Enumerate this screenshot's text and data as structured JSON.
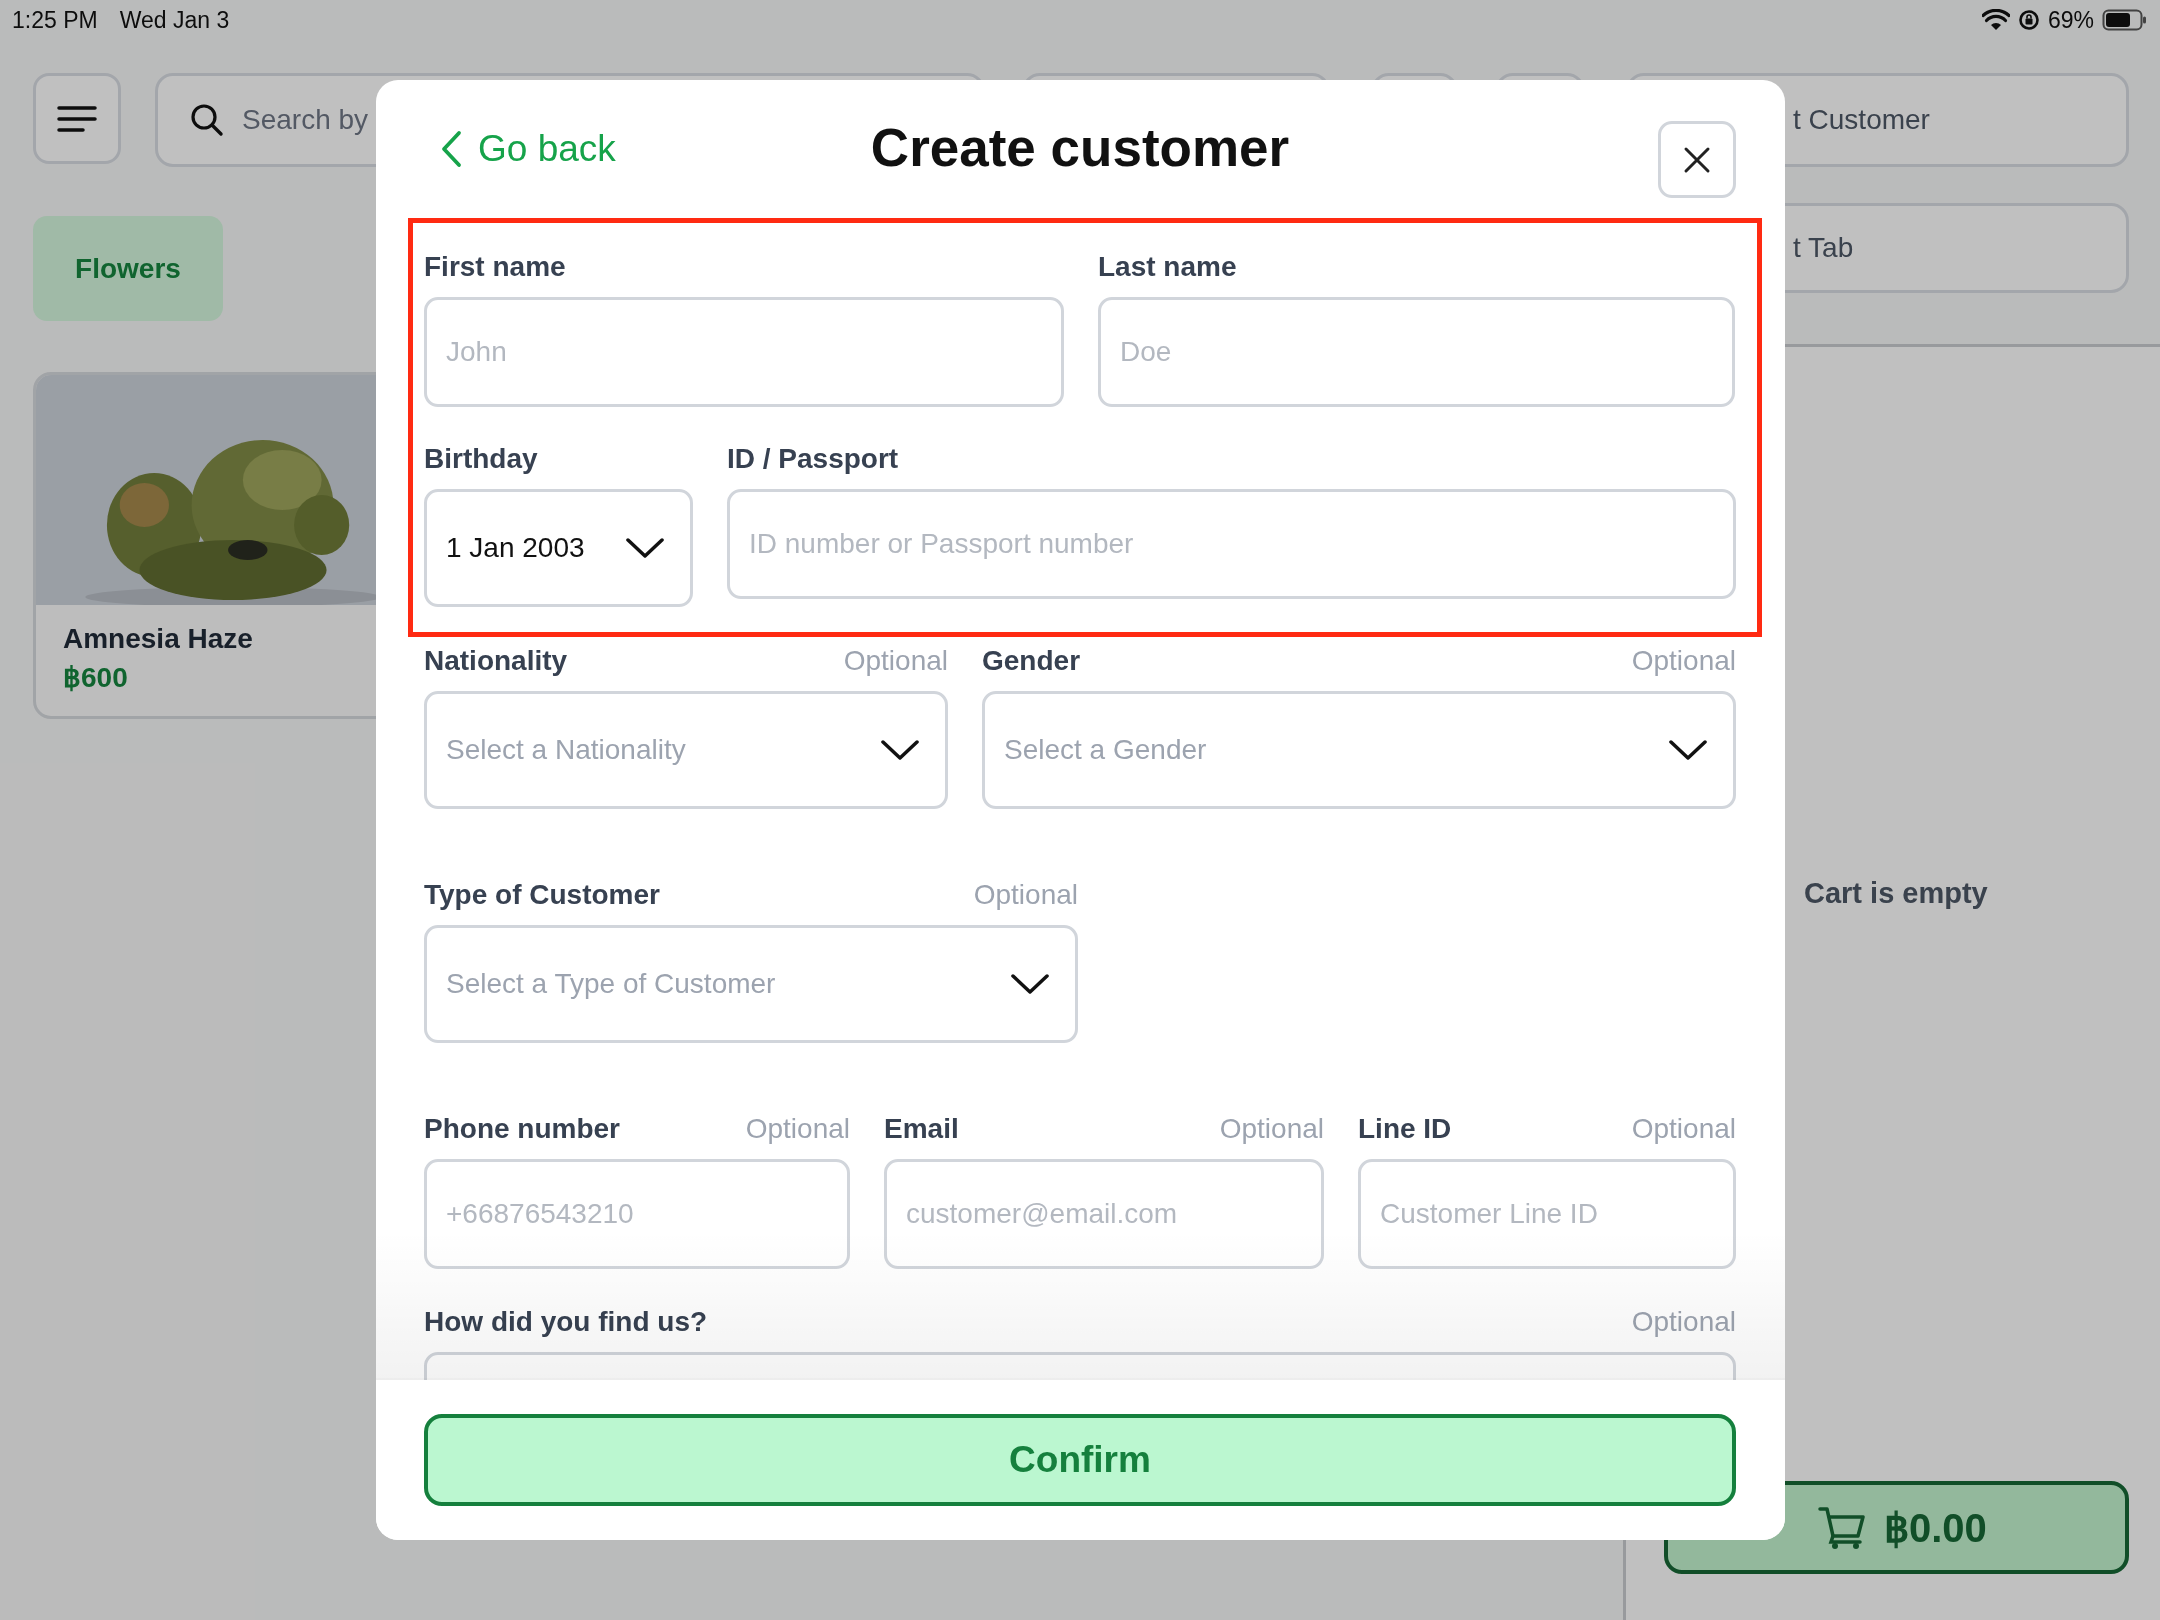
{
  "status_bar": {
    "time": "1:25 PM",
    "date": "Wed Jan 3",
    "battery": "69%"
  },
  "toolbar": {
    "search": {
      "placeholder": "Search by"
    },
    "customer_button": "t Customer",
    "tab_button": "t Tab"
  },
  "categories": [
    {
      "label": "Flowers"
    }
  ],
  "products": [
    {
      "name": "Amnesia Haze",
      "price": "฿600"
    }
  ],
  "cart": {
    "empty_message": "Cart is empty",
    "total": "฿0.00"
  },
  "dialog": {
    "back": "Go back",
    "title": "Create customer",
    "rows": [
      [
        {
          "kind": "text",
          "label": "First name",
          "placeholder": "John"
        },
        {
          "kind": "text",
          "label": "Last name",
          "placeholder": "Doe"
        }
      ],
      [
        {
          "kind": "select",
          "label": "Birthday",
          "value": "1 Jan 2003"
        },
        {
          "kind": "text",
          "label": "ID / Passport",
          "placeholder": "ID number or Passport number"
        }
      ],
      [
        {
          "kind": "select",
          "label": "Nationality",
          "optional": "Optional",
          "placeholder": "Select a Nationality"
        },
        {
          "kind": "select",
          "label": "Gender",
          "optional": "Optional",
          "placeholder": "Select a Gender"
        }
      ],
      [
        {
          "kind": "select",
          "label": "Type of Customer",
          "optional": "Optional",
          "placeholder": "Select a Type of Customer"
        }
      ],
      [
        {
          "kind": "text",
          "label": "Phone number",
          "optional": "Optional",
          "placeholder": "+66876543210"
        },
        {
          "kind": "text",
          "label": "Email",
          "optional": "Optional",
          "placeholder": "customer@email.com"
        },
        {
          "kind": "text",
          "label": "Line ID",
          "optional": "Optional",
          "placeholder": "Customer Line ID"
        }
      ],
      [
        {
          "kind": "text",
          "label": "How did you find us?",
          "optional": "Optional"
        }
      ]
    ],
    "confirm": "Confirm"
  }
}
